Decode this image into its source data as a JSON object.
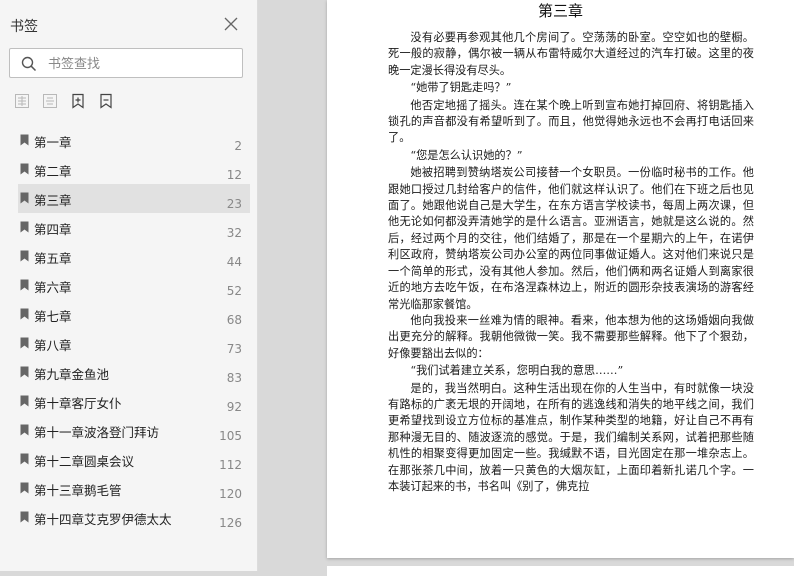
{
  "sidebar": {
    "title": "书签",
    "search_placeholder": "书签查找",
    "toc": [
      {
        "label": "第一章",
        "page": "2"
      },
      {
        "label": "第二章",
        "page": "12"
      },
      {
        "label": "第三章",
        "page": "23",
        "active": true
      },
      {
        "label": "第四章",
        "page": "32"
      },
      {
        "label": "第五章",
        "page": "44"
      },
      {
        "label": "第六章",
        "page": "52"
      },
      {
        "label": "第七章",
        "page": "68"
      },
      {
        "label": "第八章",
        "page": "73"
      },
      {
        "label": "第九章金鱼池",
        "page": "83"
      },
      {
        "label": "第十章客厅女仆",
        "page": "92"
      },
      {
        "label": "第十一章波洛登门拜访",
        "page": "105"
      },
      {
        "label": "第十二章圆桌会议",
        "page": "112"
      },
      {
        "label": "第十三章鹅毛管",
        "page": "120"
      },
      {
        "label": "第十四章艾克罗伊德太太",
        "page": "126"
      }
    ]
  },
  "document": {
    "chapter_title": "第三章",
    "paragraphs": [
      "没有必要再参观其他几个房间了。空荡荡的卧室。空空如也的壁橱。死一般的寂静，偶尔被一辆从布雷特威尔大道经过的汽车打破。这里的夜晚一定漫长得没有尽头。",
      "“她带了钥匙走吗？”",
      "他否定地摇了摇头。连在某个晚上听到宣布她打掉回府、将钥匙插入锁孔的声音都没有希望听到了。而且，他觉得她永远也不会再打电话回来了。",
      "“您是怎么认识她的？”",
      "她被招聘到赞纳塔炭公司接替一个女职员。一份临时秘书的工作。他跟她口授过几封给客户的信件，他们就这样认识了。他们在下班之后也见面了。她跟他说自己是大学生，在东方语言学校读书，每周上两次课，但他无论如何都没弄清她学的是什么语言。亚洲语言，她就是这么说的。然后，经过两个月的交往，他们结婚了，那是在一个星期六的上午，在诺伊利区政府，赞纳塔炭公司办公室的两位同事做证婚人。这对他们来说只是一个简单的形式，没有其他人参加。然后，他们俩和两名证婚人到离家很近的地方去吃午饭，在布洛涅森林边上，附近的圆形杂技表演场的游客经常光临那家餐馆。",
      "他向我投来一丝难为情的眼神。看来，他本想为他的这场婚姻向我做出更充分的解释。我朝他微微一笑。我不需要那些解释。他下了个狠劲，好像要豁出去似的：",
      "“我们试着建立关系，您明白我的意思……”",
      "是的，我当然明白。这种生活出现在你的人生当中，有时就像一块没有路标的广袤无垠的开阔地，在所有的逃逸线和消失的地平线之间，我们更希望找到设立方位标的基准点，制作某种类型的地籍，好让自己不再有那种漫无目的、随波逐流的感觉。于是，我们编制关系网，试着把那些随机性的相聚变得更加固定一些。我缄默不语，目光固定在那一堆杂志上。在那张茶几中间，放着一只黄色的大烟灰缸，上面印着新扎诺几个字。一本装订起来的书，书名叫《别了，佛克拉"
    ]
  }
}
